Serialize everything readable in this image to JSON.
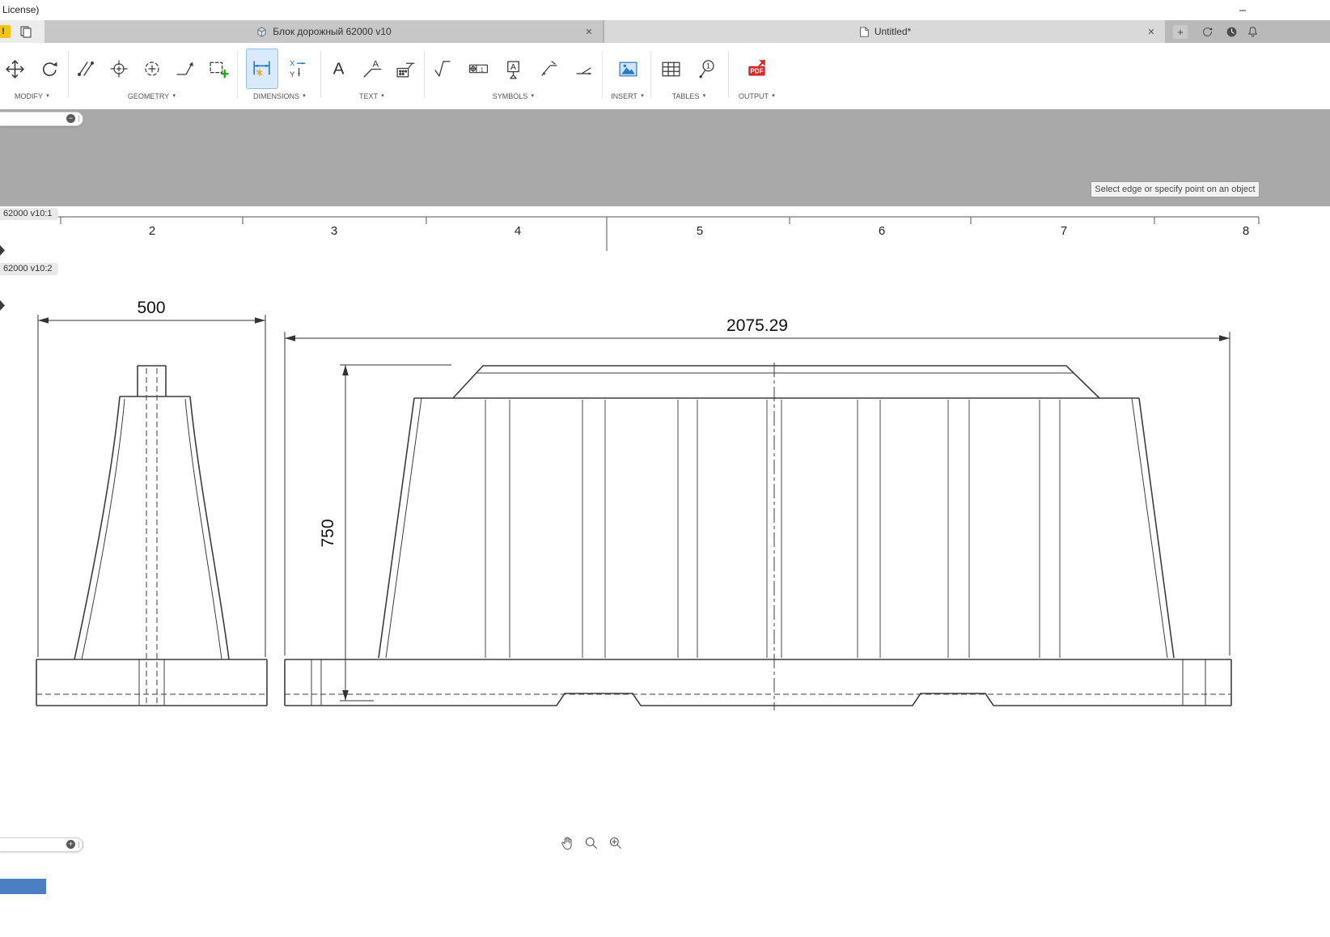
{
  "titlebar": {
    "left_text": "License)",
    "minimize_glyph": "–"
  },
  "tabbar": {
    "tab1": {
      "label": "Блок дорожный 62000 v10"
    },
    "tab2": {
      "label": "Untitled*"
    },
    "close_glyph": "✕",
    "add_glyph": "+"
  },
  "toolbar": {
    "caret": "▼",
    "groups": [
      {
        "label": "MODIFY"
      },
      {
        "label": "GEOMETRY"
      },
      {
        "label": "DIMENSIONS"
      },
      {
        "label": "TEXT"
      },
      {
        "label": "SYMBOLS"
      },
      {
        "label": "INSERT"
      },
      {
        "label": "TABLES"
      },
      {
        "label": "OUTPUT"
      }
    ],
    "icon_text": {
      "text_a": "A",
      "leader_a": "A",
      "ordinate_x": "X",
      "ordinate_y": "Y",
      "datum_letter": "A",
      "fcf_tolerance": ".1",
      "balloon_number": "1",
      "pdf": "PDF"
    }
  },
  "browser": {
    "item1": "62000 v10:1",
    "item2": "62000 v10:2"
  },
  "canvas": {
    "tooltip": "Select edge or specify point on an object",
    "ruler_numbers": [
      "2",
      "3",
      "4",
      "5",
      "6",
      "7",
      "8"
    ],
    "dimensions": {
      "front_width": "500",
      "side_height": "750",
      "side_length": "2075.29"
    }
  }
}
